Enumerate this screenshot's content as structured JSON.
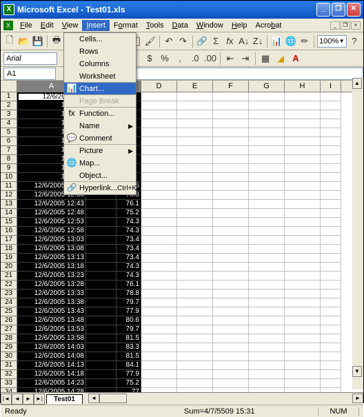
{
  "title": "Microsoft Excel - Test01.xls",
  "menu": {
    "items": [
      "File",
      "Edit",
      "View",
      "Insert",
      "Format",
      "Tools",
      "Data",
      "Window",
      "Help",
      "Acrobat"
    ],
    "open_index": 3
  },
  "insert_menu": [
    {
      "label": "Cells...",
      "icon": ""
    },
    {
      "label": "Rows",
      "icon": ""
    },
    {
      "label": "Columns",
      "icon": ""
    },
    {
      "label": "Worksheet",
      "icon": "",
      "sep": true
    },
    {
      "label": "Chart...",
      "icon": "📊",
      "hover": true,
      "sep": true
    },
    {
      "label": "Page Break",
      "icon": "",
      "disabled": true,
      "sep": true
    },
    {
      "label": "Function...",
      "icon": "fx"
    },
    {
      "label": "Name",
      "icon": "",
      "submenu": true
    },
    {
      "label": "Comment",
      "icon": "💬",
      "sep": true
    },
    {
      "label": "Picture",
      "icon": "",
      "submenu": true
    },
    {
      "label": "Map...",
      "icon": "🌐"
    },
    {
      "label": "Object...",
      "icon": "",
      "sep": true
    },
    {
      "label": "Hyperlink...",
      "icon": "🔗",
      "shortcut": "Ctrl+K"
    }
  ],
  "font": {
    "name": "Arial"
  },
  "zoom": "100%",
  "name_box": "A1",
  "formula_bar": "1:38:00 AM",
  "columns": [
    {
      "label": "A",
      "width": 100,
      "sel": true
    },
    {
      "label": "B",
      "width": 44,
      "sel": true
    },
    {
      "label": "C",
      "width": 36,
      "sel": true
    },
    {
      "label": "D",
      "width": 52
    },
    {
      "label": "E",
      "width": 52
    },
    {
      "label": "F",
      "width": 52
    },
    {
      "label": "G",
      "width": 52
    },
    {
      "label": "H",
      "width": 52
    },
    {
      "label": "I",
      "width": 30
    }
  ],
  "rows": [
    {
      "r": 1,
      "a": "12/6/2005 11:",
      "active": true
    },
    {
      "r": 2,
      "a": "12/6/20"
    },
    {
      "r": 3,
      "a": "12/6/20"
    },
    {
      "r": 4,
      "a": "12/6/20"
    },
    {
      "r": 5,
      "a": "12/6/20"
    },
    {
      "r": 6,
      "a": "12/6/20"
    },
    {
      "r": 7,
      "a": "12/6/20"
    },
    {
      "r": 8,
      "a": "12/6/20"
    },
    {
      "r": 9,
      "a": "12/6/20"
    },
    {
      "r": 10,
      "a": "12/6/20"
    },
    {
      "r": 11,
      "a": "12/6/2005 12:33",
      "c": "81.5"
    },
    {
      "r": 12,
      "a": "12/6/2005 12:38",
      "c": "78.8"
    },
    {
      "r": 13,
      "a": "12/6/2005 12:43",
      "c": "76.1"
    },
    {
      "r": 14,
      "a": "12/6/2005 12:48",
      "c": "75.2"
    },
    {
      "r": 15,
      "a": "12/6/2005 12:53",
      "c": "74.3"
    },
    {
      "r": 16,
      "a": "12/6/2005 12:58",
      "c": "74.3"
    },
    {
      "r": 17,
      "a": "12/6/2005 13:03",
      "c": "73.4"
    },
    {
      "r": 18,
      "a": "12/6/2005 13:08",
      "c": "73.4"
    },
    {
      "r": 19,
      "a": "12/6/2005 13:13",
      "c": "73.4"
    },
    {
      "r": 20,
      "a": "12/6/2005 13:18",
      "c": "74.3"
    },
    {
      "r": 21,
      "a": "12/6/2005 13:23",
      "c": "74.3"
    },
    {
      "r": 22,
      "a": "12/6/2005 13:28",
      "c": "76.1"
    },
    {
      "r": 23,
      "a": "12/6/2005 13:33",
      "c": "78.8"
    },
    {
      "r": 24,
      "a": "12/6/2005 13:38",
      "c": "79.7"
    },
    {
      "r": 25,
      "a": "12/6/2005 13:43",
      "c": "77.9"
    },
    {
      "r": 26,
      "a": "12/6/2005 13:48",
      "c": "80.6"
    },
    {
      "r": 27,
      "a": "12/6/2005 13:53",
      "c": "79.7"
    },
    {
      "r": 28,
      "a": "12/6/2005 13:58",
      "c": "81.5"
    },
    {
      "r": 29,
      "a": "12/6/2005 14:03",
      "c": "83.3"
    },
    {
      "r": 30,
      "a": "12/6/2005 14:08",
      "c": "81.5"
    },
    {
      "r": 31,
      "a": "12/6/2005 14:13",
      "c": "84.1"
    },
    {
      "r": 32,
      "a": "12/6/2005 14:18",
      "c": "77.9"
    },
    {
      "r": 33,
      "a": "12/6/2005 14:23",
      "c": "75.2"
    },
    {
      "r": 34,
      "a": "12/6/2005 14:28",
      "c": "77"
    }
  ],
  "sheet_tab": "Test01",
  "status": {
    "ready": "Ready",
    "sum": "Sum=4/7/5509 15:31",
    "num": "NUM"
  }
}
